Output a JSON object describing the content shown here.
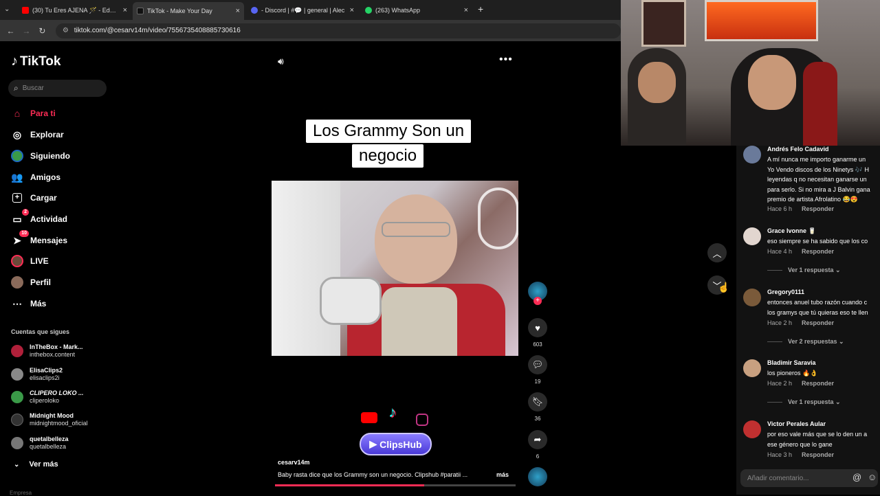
{
  "browser": {
    "tabs": [
      {
        "label": "(30) Tu Eres AJENA 🪄 - Eddy H",
        "color": "#ff0000"
      },
      {
        "label": "TikTok - Make Your Day",
        "color": "#111111"
      },
      {
        "label": "- Discord | #💬 | general | Alec",
        "color": "#5865f2"
      },
      {
        "label": "(263) WhatsApp",
        "color": "#25d366"
      }
    ],
    "new_tab": "+",
    "url": "tiktok.com/@cesarv14m/video/7556735408885730616"
  },
  "sidebar": {
    "logo": "TikTok",
    "search_placeholder": "Buscar",
    "nav": [
      {
        "label": "Para ti",
        "icon": "home-icon",
        "active": true
      },
      {
        "label": "Explorar",
        "icon": "compass-icon"
      },
      {
        "label": "Siguiendo",
        "icon": "following-icon"
      },
      {
        "label": "Amigos",
        "icon": "friends-icon"
      },
      {
        "label": "Cargar",
        "icon": "upload-icon"
      },
      {
        "label": "Actividad",
        "icon": "activity-icon",
        "badge": "2"
      },
      {
        "label": "Mensajes",
        "icon": "messages-icon",
        "badge": "10"
      },
      {
        "label": "LIVE",
        "icon": "live-icon"
      },
      {
        "label": "Perfil",
        "icon": "profile-icon"
      },
      {
        "label": "Más",
        "icon": "more-icon"
      }
    ],
    "following_title": "Cuentas que sigues",
    "following": [
      {
        "name": "InTheBox - Mark...",
        "handle": "inthebox.content",
        "color": "#b0203a"
      },
      {
        "name": "ElisaClips2",
        "handle": "elisaclips2i",
        "color": "#888888"
      },
      {
        "name": "CLIPERO LOKO ...",
        "handle": "cliperoloko",
        "color": "#3a9a48"
      },
      {
        "name": "Midnight Mood",
        "handle": "midnightmood_oficial",
        "color": "#333333"
      },
      {
        "name": "quetalbelleza",
        "handle": "quetalbelleza",
        "color": "#777777"
      }
    ],
    "see_more": "Ver más",
    "footer_partial": "Empresa"
  },
  "video": {
    "caption_line1": "Los Grammy Son un",
    "caption_line2": "negocio",
    "clipshub_label": "ClipsHub",
    "author": "cesarv14m",
    "description": "Baby rasta dice que los Grammy son un negocio. Clipshub #paratii  ...",
    "more": "más",
    "likes": "603",
    "comments": "19",
    "saves": "36",
    "shares": "6"
  },
  "comments": [
    {
      "name": "Andrés Felo Cadavid",
      "text": "A mí nunca me importo ganarme un\nYo Vendo discos de los Ninetys 🎶 H\nleyendas q no necesitan ganarse un\npara serlo. Si no mira a J Balvin gana\npremio de artista Afrolatino 😂😍",
      "time": "Hace 6 h",
      "reply": "Responder",
      "color": "#6a7a9a"
    },
    {
      "name": "Grace Ivonne 🥛",
      "text": "eso siempre se ha sabido que los co",
      "time": "Hace 4 h",
      "reply": "Responder",
      "more": "Ver 1 respuesta ⌄",
      "color": "#e2d6cf"
    },
    {
      "name": "Gregory0111",
      "text": "entonces anuel tubo razón cuando c\nlos gramys que tú quieras eso te llen",
      "time": "Hace 2 h",
      "reply": "Responder",
      "more": "Ver 2 respuestas ⌄",
      "color": "#7a5a3a"
    },
    {
      "name": "Bladimir Saravia",
      "text": "los pioneros 🔥👌",
      "time": "Hace 2 h",
      "reply": "Responder",
      "more": "Ver 1 respuesta ⌄",
      "color": "#c8a080"
    },
    {
      "name": "Victor Perales Aular",
      "text": "por eso vale más que se lo den un a\nese género que lo gane",
      "time": "Hace 3 h",
      "reply": "Responder",
      "color": "#c03030"
    }
  ],
  "comment_input_placeholder": "Añadir comentario..."
}
